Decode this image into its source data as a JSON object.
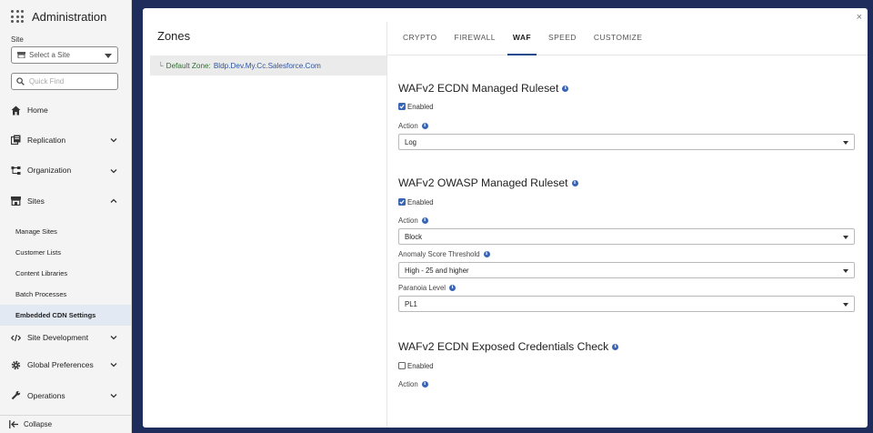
{
  "app": {
    "title": "Administration"
  },
  "site": {
    "label": "Site",
    "select_value": "Select a Site"
  },
  "quick_find": {
    "placeholder": "Quick Find"
  },
  "nav": {
    "home": "Home",
    "replication": "Replication",
    "organization": "Organization",
    "sites": "Sites",
    "sites_children": [
      "Manage Sites",
      "Customer Lists",
      "Content Libraries",
      "Batch Processes",
      "Embedded CDN Settings"
    ],
    "site_development": "Site Development",
    "global_preferences": "Global Preferences",
    "operations": "Operations",
    "collapse": "Collapse"
  },
  "modal": {
    "close": "×",
    "zones_title": "Zones",
    "zone": {
      "name": "Default Zone:",
      "host": "Bldp.Dev.My.Cc.Salesforce.Com"
    },
    "tabs": [
      "CRYPTO",
      "FIREWALL",
      "WAF",
      "SPEED",
      "CUSTOMIZE"
    ],
    "active_tab": "WAF"
  },
  "waf": {
    "managed": {
      "title": "WAFv2 ECDN Managed Ruleset",
      "enabled_label": "Enabled",
      "enabled": true,
      "action_label": "Action",
      "action_value": "Log"
    },
    "owasp": {
      "title": "WAFv2 OWASP Managed Ruleset",
      "enabled_label": "Enabled",
      "enabled": true,
      "action_label": "Action",
      "action_value": "Block",
      "anomaly_label": "Anomaly Score Threshold",
      "anomaly_value": "High - 25 and higher",
      "paranoia_label": "Paranoia Level",
      "paranoia_value": "PL1"
    },
    "exposed": {
      "title": "WAFv2 ECDN Exposed Credentials Check",
      "enabled_label": "Enabled",
      "enabled": false,
      "action_label": "Action"
    }
  },
  "colors": {
    "accent": "#1b4a8f",
    "info": "#3a64b5",
    "backdrop": "#1f2d5c",
    "active_nav": "#e2e9f3"
  }
}
